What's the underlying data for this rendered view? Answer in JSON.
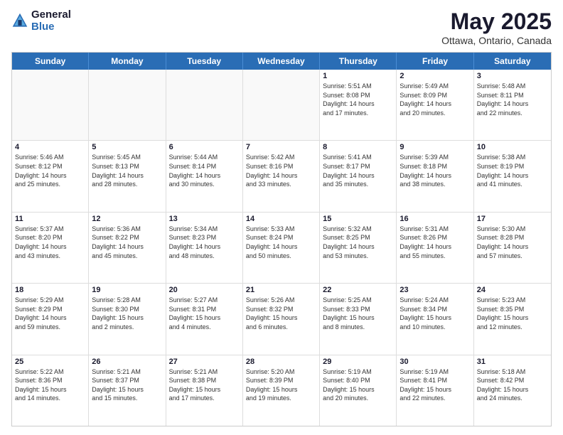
{
  "header": {
    "logo_line1": "General",
    "logo_line2": "Blue",
    "month": "May 2025",
    "location": "Ottawa, Ontario, Canada"
  },
  "days": [
    "Sunday",
    "Monday",
    "Tuesday",
    "Wednesday",
    "Thursday",
    "Friday",
    "Saturday"
  ],
  "rows": [
    [
      {
        "num": "",
        "info": ""
      },
      {
        "num": "",
        "info": ""
      },
      {
        "num": "",
        "info": ""
      },
      {
        "num": "",
        "info": ""
      },
      {
        "num": "1",
        "info": "Sunrise: 5:51 AM\nSunset: 8:08 PM\nDaylight: 14 hours\nand 17 minutes."
      },
      {
        "num": "2",
        "info": "Sunrise: 5:49 AM\nSunset: 8:09 PM\nDaylight: 14 hours\nand 20 minutes."
      },
      {
        "num": "3",
        "info": "Sunrise: 5:48 AM\nSunset: 8:11 PM\nDaylight: 14 hours\nand 22 minutes."
      }
    ],
    [
      {
        "num": "4",
        "info": "Sunrise: 5:46 AM\nSunset: 8:12 PM\nDaylight: 14 hours\nand 25 minutes."
      },
      {
        "num": "5",
        "info": "Sunrise: 5:45 AM\nSunset: 8:13 PM\nDaylight: 14 hours\nand 28 minutes."
      },
      {
        "num": "6",
        "info": "Sunrise: 5:44 AM\nSunset: 8:14 PM\nDaylight: 14 hours\nand 30 minutes."
      },
      {
        "num": "7",
        "info": "Sunrise: 5:42 AM\nSunset: 8:16 PM\nDaylight: 14 hours\nand 33 minutes."
      },
      {
        "num": "8",
        "info": "Sunrise: 5:41 AM\nSunset: 8:17 PM\nDaylight: 14 hours\nand 35 minutes."
      },
      {
        "num": "9",
        "info": "Sunrise: 5:39 AM\nSunset: 8:18 PM\nDaylight: 14 hours\nand 38 minutes."
      },
      {
        "num": "10",
        "info": "Sunrise: 5:38 AM\nSunset: 8:19 PM\nDaylight: 14 hours\nand 41 minutes."
      }
    ],
    [
      {
        "num": "11",
        "info": "Sunrise: 5:37 AM\nSunset: 8:20 PM\nDaylight: 14 hours\nand 43 minutes."
      },
      {
        "num": "12",
        "info": "Sunrise: 5:36 AM\nSunset: 8:22 PM\nDaylight: 14 hours\nand 45 minutes."
      },
      {
        "num": "13",
        "info": "Sunrise: 5:34 AM\nSunset: 8:23 PM\nDaylight: 14 hours\nand 48 minutes."
      },
      {
        "num": "14",
        "info": "Sunrise: 5:33 AM\nSunset: 8:24 PM\nDaylight: 14 hours\nand 50 minutes."
      },
      {
        "num": "15",
        "info": "Sunrise: 5:32 AM\nSunset: 8:25 PM\nDaylight: 14 hours\nand 53 minutes."
      },
      {
        "num": "16",
        "info": "Sunrise: 5:31 AM\nSunset: 8:26 PM\nDaylight: 14 hours\nand 55 minutes."
      },
      {
        "num": "17",
        "info": "Sunrise: 5:30 AM\nSunset: 8:28 PM\nDaylight: 14 hours\nand 57 minutes."
      }
    ],
    [
      {
        "num": "18",
        "info": "Sunrise: 5:29 AM\nSunset: 8:29 PM\nDaylight: 14 hours\nand 59 minutes."
      },
      {
        "num": "19",
        "info": "Sunrise: 5:28 AM\nSunset: 8:30 PM\nDaylight: 15 hours\nand 2 minutes."
      },
      {
        "num": "20",
        "info": "Sunrise: 5:27 AM\nSunset: 8:31 PM\nDaylight: 15 hours\nand 4 minutes."
      },
      {
        "num": "21",
        "info": "Sunrise: 5:26 AM\nSunset: 8:32 PM\nDaylight: 15 hours\nand 6 minutes."
      },
      {
        "num": "22",
        "info": "Sunrise: 5:25 AM\nSunset: 8:33 PM\nDaylight: 15 hours\nand 8 minutes."
      },
      {
        "num": "23",
        "info": "Sunrise: 5:24 AM\nSunset: 8:34 PM\nDaylight: 15 hours\nand 10 minutes."
      },
      {
        "num": "24",
        "info": "Sunrise: 5:23 AM\nSunset: 8:35 PM\nDaylight: 15 hours\nand 12 minutes."
      }
    ],
    [
      {
        "num": "25",
        "info": "Sunrise: 5:22 AM\nSunset: 8:36 PM\nDaylight: 15 hours\nand 14 minutes."
      },
      {
        "num": "26",
        "info": "Sunrise: 5:21 AM\nSunset: 8:37 PM\nDaylight: 15 hours\nand 15 minutes."
      },
      {
        "num": "27",
        "info": "Sunrise: 5:21 AM\nSunset: 8:38 PM\nDaylight: 15 hours\nand 17 minutes."
      },
      {
        "num": "28",
        "info": "Sunrise: 5:20 AM\nSunset: 8:39 PM\nDaylight: 15 hours\nand 19 minutes."
      },
      {
        "num": "29",
        "info": "Sunrise: 5:19 AM\nSunset: 8:40 PM\nDaylight: 15 hours\nand 20 minutes."
      },
      {
        "num": "30",
        "info": "Sunrise: 5:19 AM\nSunset: 8:41 PM\nDaylight: 15 hours\nand 22 minutes."
      },
      {
        "num": "31",
        "info": "Sunrise: 5:18 AM\nSunset: 8:42 PM\nDaylight: 15 hours\nand 24 minutes."
      }
    ]
  ],
  "empty_cols_row1": [
    0,
    1,
    2,
    3
  ],
  "shaded_rows": []
}
